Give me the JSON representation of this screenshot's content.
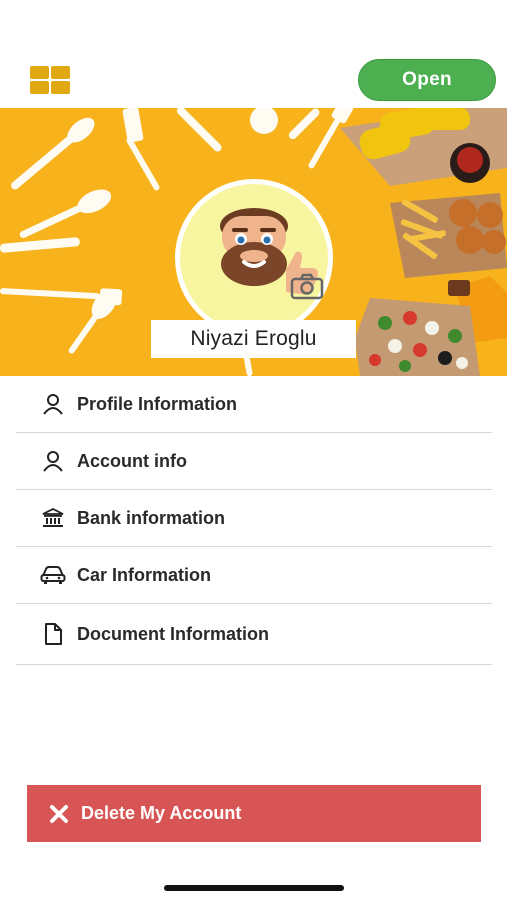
{
  "header": {
    "menu_icon": "grid-icon",
    "status_button_label": "Open",
    "status_color": "#4caf50"
  },
  "profile": {
    "name": "Niyazi Eroglu",
    "avatar_icon": "memoji-avatar",
    "camera_icon": "camera-icon",
    "banner_bg_color": "#f8b21b"
  },
  "menu": {
    "items": [
      {
        "label": "Profile Information",
        "icon": "user-icon"
      },
      {
        "label": "Account info",
        "icon": "user-icon"
      },
      {
        "label": "Bank information",
        "icon": "bank-icon"
      },
      {
        "label": "Car Information",
        "icon": "car-icon"
      },
      {
        "label": "Document Information",
        "icon": "document-icon"
      }
    ]
  },
  "actions": {
    "delete_label": "Delete My Account",
    "delete_icon": "close-icon",
    "delete_color": "#d85555"
  }
}
